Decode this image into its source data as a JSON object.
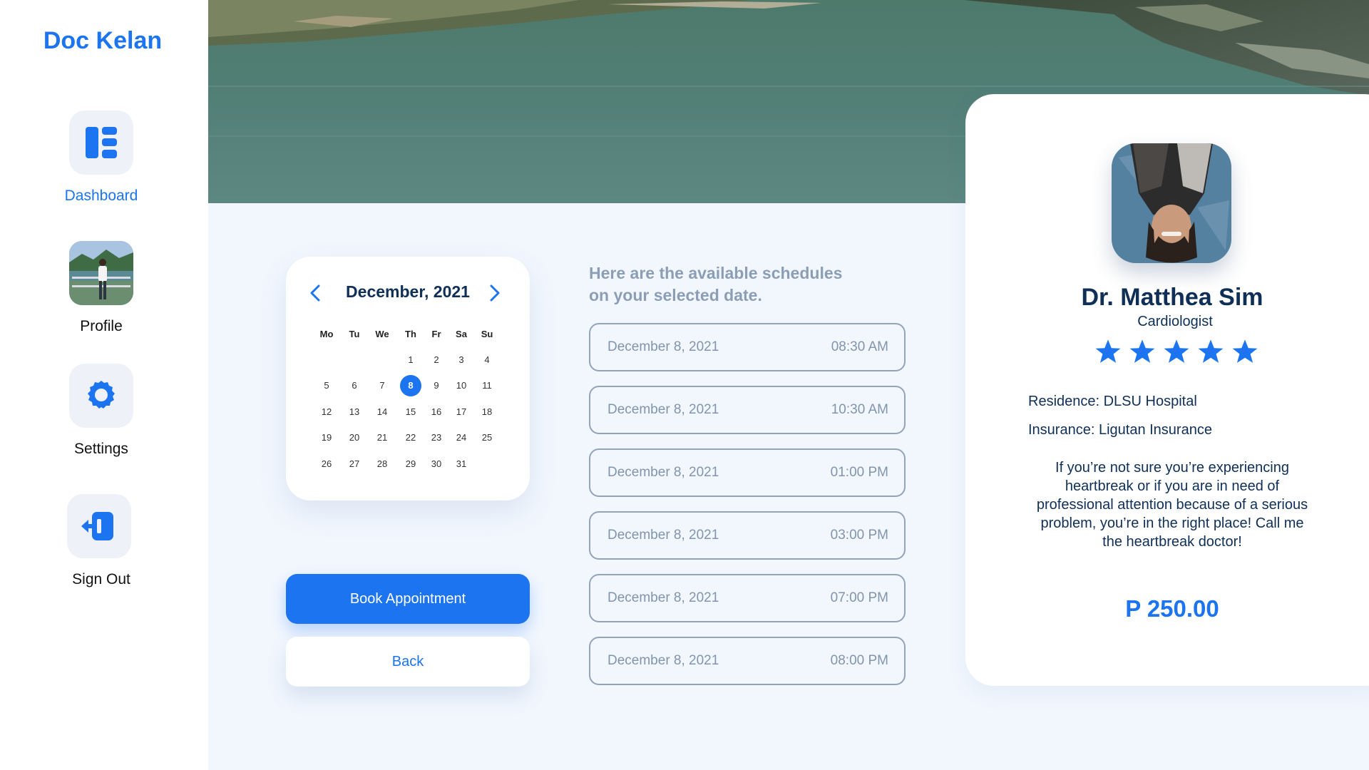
{
  "app": {
    "title": "Doc Kelan"
  },
  "sidebar": {
    "items": [
      {
        "label": "Dashboard",
        "icon": "dashboard-icon",
        "active": true
      },
      {
        "label": "Profile",
        "icon": "profile-avatar"
      },
      {
        "label": "Settings",
        "icon": "gear-icon"
      },
      {
        "label": "Sign Out",
        "icon": "sign-out-icon"
      }
    ]
  },
  "calendar": {
    "month_label": "December, 2021",
    "weekdays": [
      "Mo",
      "Tu",
      "We",
      "Th",
      "Fr",
      "Sa",
      "Su"
    ],
    "first_weekday_index": 3,
    "days_in_month": 31,
    "selected_day": 8
  },
  "buttons": {
    "book": "Book Appointment",
    "back": "Back"
  },
  "schedules": {
    "title_line1": "Here are the available schedules",
    "title_line2": "on your selected date.",
    "slots": [
      {
        "date": "December 8, 2021",
        "time": "08:30 AM"
      },
      {
        "date": "December 8, 2021",
        "time": "10:30 AM"
      },
      {
        "date": "December 8, 2021",
        "time": "01:00 PM"
      },
      {
        "date": "December 8, 2021",
        "time": "03:00 PM"
      },
      {
        "date": "December 8, 2021",
        "time": "07:00 PM"
      },
      {
        "date": "December 8, 2021",
        "time": "08:00 PM"
      }
    ]
  },
  "doctor": {
    "name": "Dr. Matthea Sim",
    "specialty": "Cardiologist",
    "rating": 5,
    "residence": "Residence: DLSU Hospital",
    "insurance": "Insurance: Ligutan Insurance",
    "bio": "If you’re not sure you’re experiencing heartbreak or if you are in need of professional attention because of a serious problem, you’re in the right place! Call me the heartbreak doctor!",
    "price": "P 250.00"
  },
  "colors": {
    "accent": "#1c74f0",
    "navy": "#0f2f57",
    "muted": "#8c9eb5",
    "background": "#f2f7fe"
  }
}
